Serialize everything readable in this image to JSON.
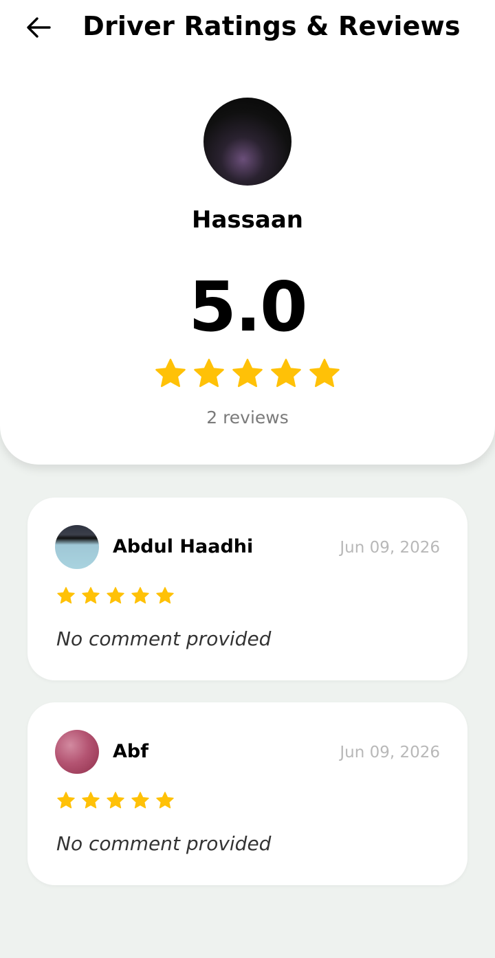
{
  "header": {
    "title": "Driver Ratings & Reviews",
    "back_icon": "arrow-left-icon"
  },
  "driver": {
    "name": "Hassaan",
    "rating": "5.0",
    "stars": 5,
    "review_count_label": "2 reviews"
  },
  "reviews": [
    {
      "name": "Abdul Haadhi",
      "date": "Jun 09, 2026",
      "stars": 5,
      "comment": "No comment provided"
    },
    {
      "name": "Abf",
      "date": "Jun 09, 2026",
      "stars": 5,
      "comment": "No comment provided"
    }
  ],
  "colors": {
    "star": "#FFC107",
    "background": "#EEF2EF",
    "card": "#FFFFFF",
    "muted_text": "#7A7A7A",
    "date_text": "#B8B8B8"
  }
}
